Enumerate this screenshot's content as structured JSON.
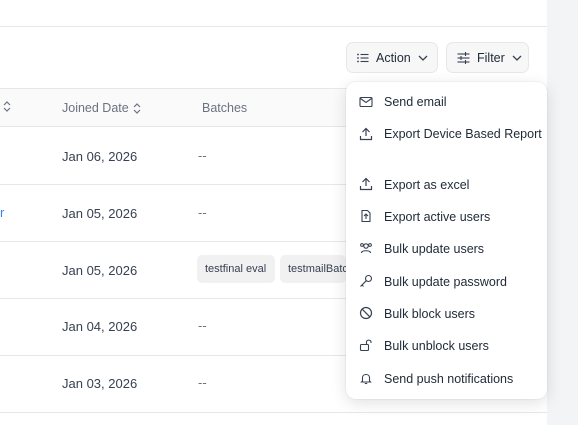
{
  "toolbar": {
    "action_label": "Action",
    "filter_label": "Filter"
  },
  "table": {
    "headers": {
      "joined_date": "Joined Date",
      "batches": "Batches"
    },
    "rows": [
      {
        "joined": "Jan 06, 2026",
        "batches": "--",
        "batch_tags": []
      },
      {
        "joined": "Jan 05, 2026",
        "batches": "--",
        "batch_tags": []
      },
      {
        "joined": "Jan 05, 2026",
        "batches": "",
        "batch_tags": [
          "testfinal eval",
          "testmailBatc"
        ]
      },
      {
        "joined": "Jan 04, 2026",
        "batches": "--",
        "batch_tags": []
      },
      {
        "joined": "Jan 03, 2026",
        "batches": "--",
        "batch_tags": []
      }
    ]
  },
  "action_menu": {
    "items": [
      {
        "label": "Send email",
        "icon": "mail-icon"
      },
      {
        "label": "Export Device Based Report",
        "icon": "upload-icon"
      },
      {
        "label": "Export as excel",
        "icon": "upload-icon"
      },
      {
        "label": "Export active users",
        "icon": "file-export-icon"
      },
      {
        "label": "Bulk update users",
        "icon": "users-icon"
      },
      {
        "label": "Bulk update password",
        "icon": "key-icon"
      },
      {
        "label": "Bulk block users",
        "icon": "block-icon"
      },
      {
        "label": "Bulk unblock users",
        "icon": "unlock-icon"
      },
      {
        "label": "Send push notifications",
        "icon": "bell-icon"
      }
    ]
  }
}
